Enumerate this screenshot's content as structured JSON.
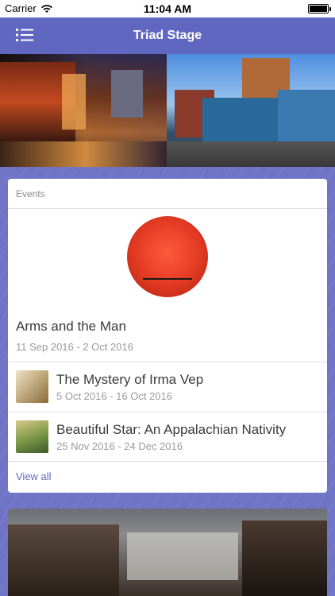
{
  "status_bar": {
    "carrier": "Carrier",
    "time": "11:04 AM"
  },
  "navbar": {
    "title": "Triad Stage",
    "menu_icon": "list-menu-icon"
  },
  "colors": {
    "nav_bg": "#5f67c0",
    "page_bg": "#6f74c6",
    "link": "#5f67c0"
  },
  "events": {
    "header": "Events",
    "featured": {
      "title": "Arms and the Man",
      "dates": "11 Sep 2016 - 2 Oct 2016"
    },
    "items": [
      {
        "title": "The Mystery of Irma Vep",
        "dates": "5 Oct 2016 - 16 Oct 2016"
      },
      {
        "title": "Beautiful Star: An Appalachian Nativity",
        "dates": "25 Nov 2016 - 24 Dec 2016"
      }
    ],
    "view_all": "View all"
  }
}
